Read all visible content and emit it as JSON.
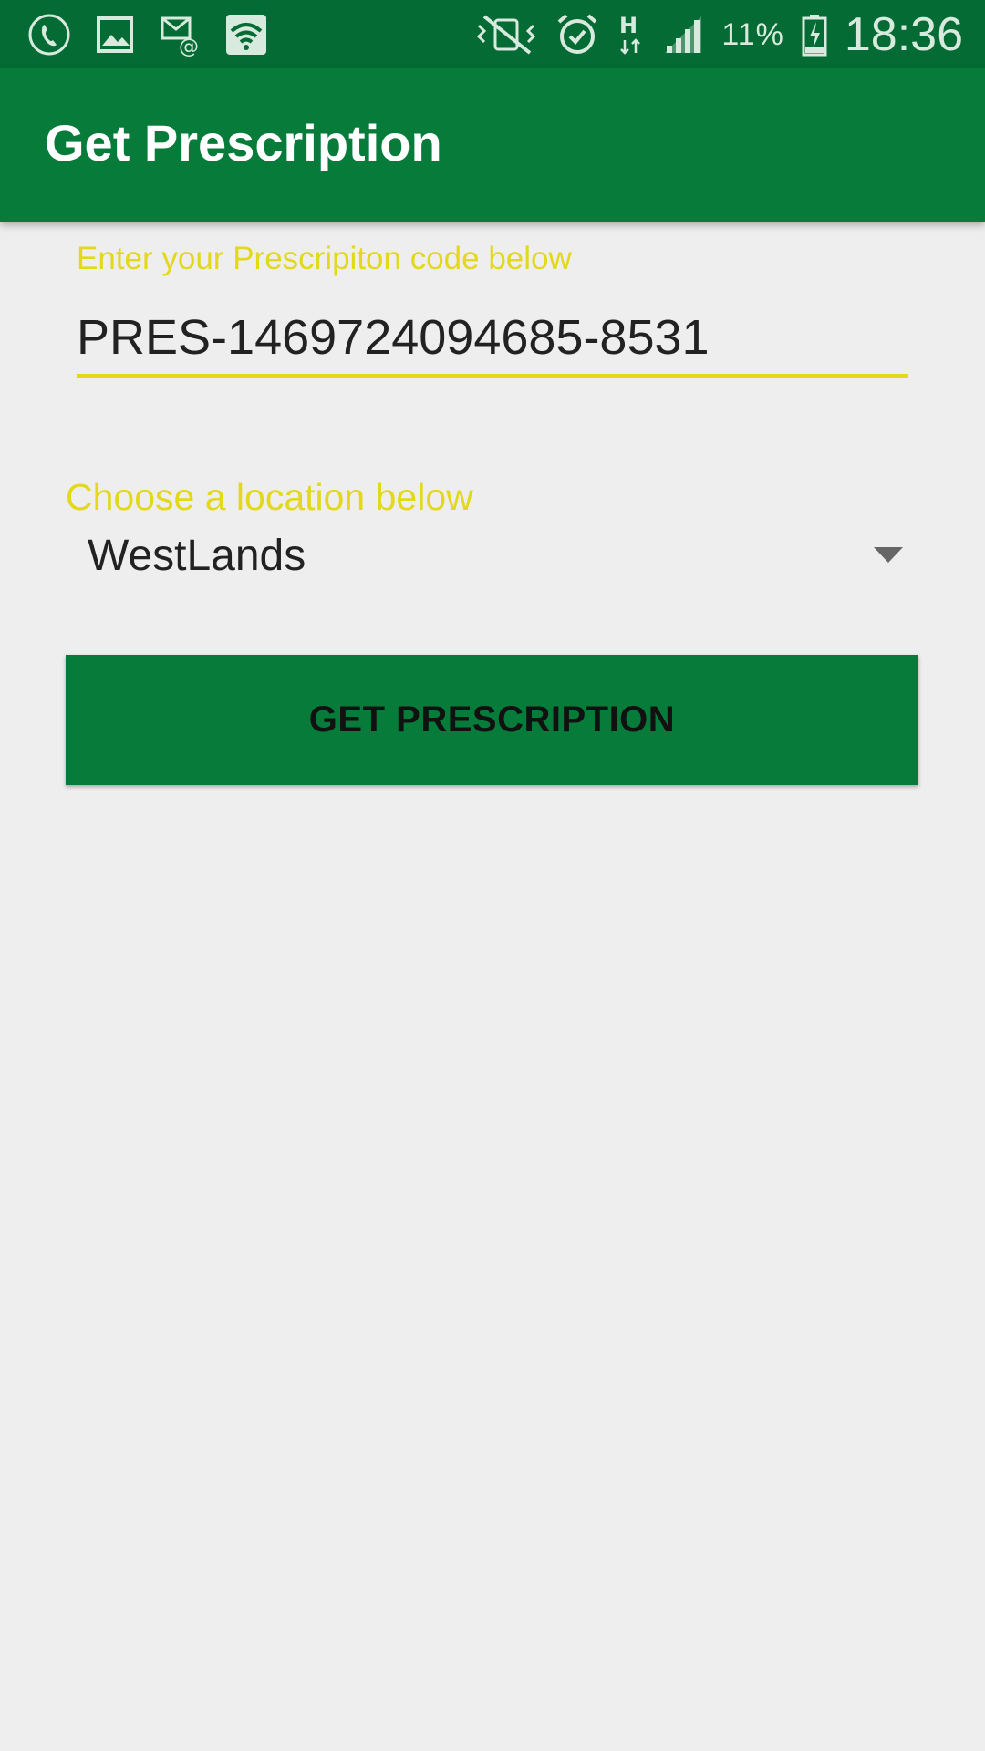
{
  "status_bar": {
    "left_icons": [
      "phone-call-icon",
      "image-icon",
      "email-notification-icon",
      "wifi-icon"
    ],
    "right_icons": [
      "vibrate-icon",
      "alarm-icon",
      "network-h-icon",
      "signal-icon",
      "battery-charging-icon"
    ],
    "battery": "11%",
    "time": "18:36"
  },
  "app_bar": {
    "title": "Get Prescription"
  },
  "form": {
    "code_label": "Enter your Prescripiton code below",
    "code_value": "PRES-1469724094685-8531",
    "location_label": "Choose a location below",
    "location_selected": "WestLands",
    "submit_label": "GET PRESCRIPTION"
  },
  "colors": {
    "primary": "#067b3a",
    "status_bar": "#056b34",
    "accent": "#e3d81b",
    "background": "#eeeeee"
  }
}
